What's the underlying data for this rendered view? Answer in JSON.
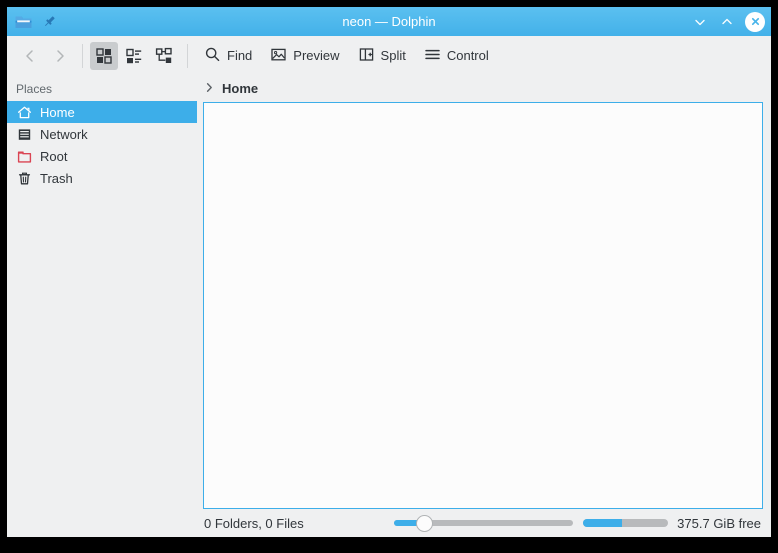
{
  "window": {
    "title": "neon — Dolphin",
    "icon": "folder-icon",
    "pin_icon": "pin-icon",
    "controls": {
      "minimize": "minimize-icon",
      "maximize": "maximize-icon",
      "close": "close-icon"
    }
  },
  "toolbar": {
    "back_label": "Back",
    "forward_label": "Forward",
    "view_modes": [
      {
        "name": "icons-view",
        "label": "Icons",
        "selected": true
      },
      {
        "name": "details-view",
        "label": "Details",
        "selected": false
      },
      {
        "name": "compact-view",
        "label": "Compact",
        "selected": false
      }
    ],
    "items": [
      {
        "name": "find",
        "label": "Find",
        "icon": "search-icon"
      },
      {
        "name": "preview",
        "label": "Preview",
        "icon": "image-icon"
      },
      {
        "name": "split",
        "label": "Split",
        "icon": "split-icon"
      },
      {
        "name": "control",
        "label": "Control",
        "icon": "hamburger-icon"
      }
    ]
  },
  "sidebar": {
    "header": "Places",
    "items": [
      {
        "label": "Home",
        "icon": "home-icon",
        "selected": true
      },
      {
        "label": "Network",
        "icon": "network-icon",
        "selected": false
      },
      {
        "label": "Root",
        "icon": "root-folder-icon",
        "selected": false
      },
      {
        "label": "Trash",
        "icon": "trash-icon",
        "selected": false
      }
    ]
  },
  "breadcrumb": {
    "chevron": "chevron-right-icon",
    "current": "Home"
  },
  "view": {
    "empty": true,
    "contents": []
  },
  "statusbar": {
    "item_count": "0 Folders, 0 Files",
    "zoom_value": 12,
    "capacity_used_percent": 45,
    "free_space": "375.7 GiB free"
  },
  "colors": {
    "accent": "#3daee9",
    "titlebar_top": "#5bc0f0",
    "titlebar_bottom": "#43b1e9",
    "chrome": "#eff0f1",
    "view_bg": "#fcfcfc",
    "text": "#31363b",
    "root_red": "#da4453"
  }
}
